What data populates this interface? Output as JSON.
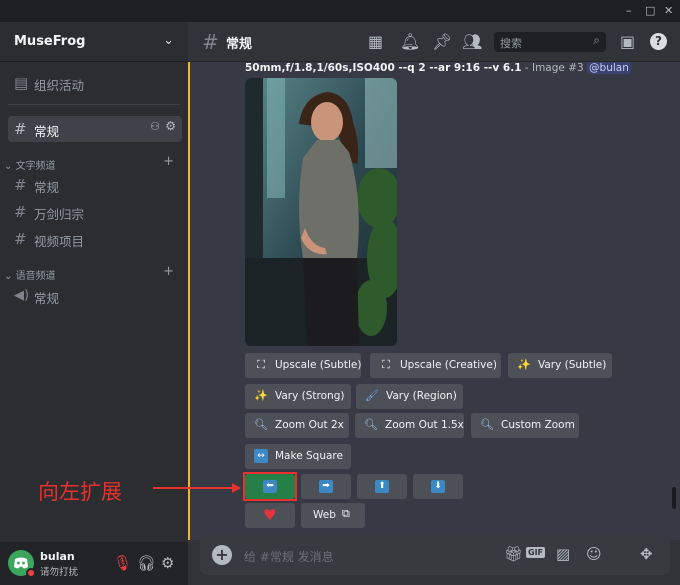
{
  "window": {
    "minimize": "–",
    "maximize": "□",
    "close": "✕"
  },
  "server": {
    "name": "MuseFrog",
    "chevron": "⌄"
  },
  "sidebar": {
    "events_label": "组织活动",
    "active_channel": "常规",
    "text_category": "文字频道",
    "text_channels": [
      "常规",
      "万剑归宗",
      "视频项目"
    ],
    "voice_category": "语音频道",
    "voice_channels": [
      "常规"
    ]
  },
  "user": {
    "name": "bulan",
    "status": "请勿打扰"
  },
  "header": {
    "channel": "常规",
    "search_placeholder": "搜索"
  },
  "message": {
    "prompt_bold": "50mm,f/1.8,1/60s,ISO400 --q 2 --ar 9:16 --v 6.1",
    "prompt_meta": " - Image #3 ",
    "mention": "@bulan"
  },
  "buttons": {
    "upscale_subtle": "Upscale (Subtle)",
    "upscale_creative": "Upscale (Creative)",
    "vary_subtle": "Vary (Subtle)",
    "vary_strong": "Vary (Strong)",
    "vary_region": "Vary (Region)",
    "zoom_out_2x": "Zoom Out 2x",
    "zoom_out_15x": "Zoom Out 1.5x",
    "custom_zoom": "Custom Zoom",
    "make_square": "Make Square",
    "pan_left": "⬅",
    "pan_right": "➡",
    "pan_up": "⬆",
    "pan_down": "⬇",
    "heart": "♥",
    "web": "Web"
  },
  "annotation": {
    "text": "向左扩展"
  },
  "composer": {
    "placeholder": "给 #常规 发消息",
    "gif": "GIF"
  },
  "colors": {
    "accent": "#f0b232",
    "highlight": "#e8302c",
    "pan_blue": "#3b88c3",
    "sidebar": "#2b2d31",
    "main": "#313338"
  }
}
